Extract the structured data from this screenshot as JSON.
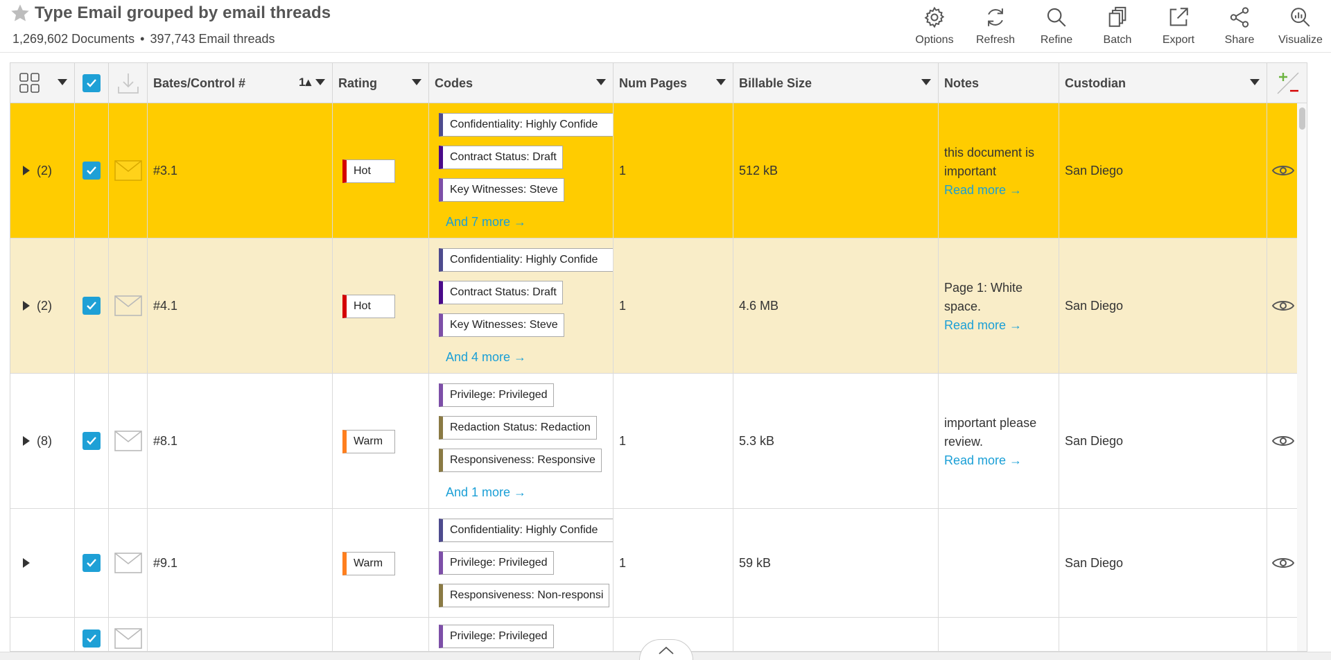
{
  "header": {
    "title": "Type Email grouped by email threads",
    "documents": "1,269,602 Documents",
    "separator": "•",
    "threads": "397,743 Email threads"
  },
  "toolbar": [
    {
      "label": "Options",
      "icon": "gear-icon"
    },
    {
      "label": "Refresh",
      "icon": "refresh-icon"
    },
    {
      "label": "Refine",
      "icon": "search-icon"
    },
    {
      "label": "Batch",
      "icon": "batch-icon"
    },
    {
      "label": "Export",
      "icon": "export-icon"
    },
    {
      "label": "Share",
      "icon": "share-icon"
    },
    {
      "label": "Visualize",
      "icon": "visualize-icon"
    }
  ],
  "columns": {
    "bates": "Bates/Control #",
    "sort": "1▴",
    "rating": "Rating",
    "codes": "Codes",
    "num_pages": "Num Pages",
    "billable_size": "Billable Size",
    "notes": "Notes",
    "custodian": "Custodian"
  },
  "rows": [
    {
      "count": "(2)",
      "bates": "#3.1",
      "rating": "Hot",
      "num_pages": "1",
      "size": "512 kB",
      "codes": [
        "Confidentiality: Highly Confide",
        "Contract Status: Draft",
        "Key Witnesses: Steve"
      ],
      "more": "And 7 more →",
      "note": "this document is important",
      "read_more": "Read more →",
      "custodian": "San Diego"
    },
    {
      "count": "(2)",
      "bates": "#4.1",
      "rating": "Hot",
      "num_pages": "1",
      "size": "4.6 MB",
      "codes": [
        "Confidentiality: Highly Confide",
        "Contract Status: Draft",
        "Key Witnesses: Steve"
      ],
      "more": "And 4 more →",
      "note": "Page 1: White space.",
      "read_more": "Read more →",
      "custodian": "San Diego"
    },
    {
      "count": "(8)",
      "bates": "#8.1",
      "rating": "Warm",
      "num_pages": "1",
      "size": "5.3 kB",
      "codes": [
        "Privilege: Privileged",
        "Redaction Status: Redaction",
        "Responsiveness: Responsive"
      ],
      "more": "And 1 more →",
      "note": "important please review.",
      "read_more": "Read more →",
      "custodian": "San Diego"
    },
    {
      "count": "",
      "bates": "#9.1",
      "rating": "Warm",
      "num_pages": "1",
      "size": "59 kB",
      "codes": [
        "Confidentiality: Highly Confide",
        "Privilege: Privileged",
        "Responsiveness: Non-responsi"
      ],
      "more": "",
      "note": "",
      "read_more": "",
      "custodian": "San Diego"
    },
    {
      "count": "",
      "bates": "",
      "rating": "",
      "num_pages": "",
      "size": "",
      "codes": [
        "Privilege: Privileged"
      ],
      "more": "",
      "note": "",
      "read_more": "",
      "custodian": ""
    }
  ],
  "colors": {
    "selected_row": "#ffcc00",
    "highlight_row": "#f9edc8",
    "checkbox": "#1ea0d6",
    "link": "#1a9fd6",
    "hot": "#d40000",
    "warm": "#ff7f1e"
  }
}
